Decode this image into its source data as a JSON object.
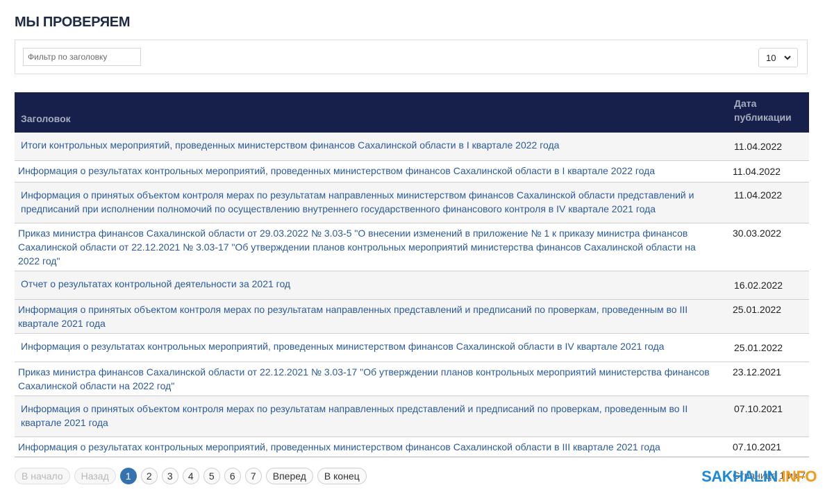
{
  "page_title": "МЫ ПРОВЕРЯЕМ",
  "filter": {
    "placeholder": "Фильтр по заголовку",
    "value": ""
  },
  "page_size": {
    "selected": "10"
  },
  "table": {
    "headers": {
      "title": "Заголовок",
      "date": "Дата публикации"
    },
    "rows": [
      {
        "title": "Итоги контрольных мероприятий, проведенных министерством финансов Сахалинской области в I квартале 2022 года",
        "date": "11.04.2022"
      },
      {
        "title": "Информация о результатах контрольных мероприятий, проведенных министерством финансов Сахалинской области в I квартале 2022 года",
        "date": "11.04.2022"
      },
      {
        "title": "Информация о принятых объектом контроля мерах по результатам направленных министерством финансов Сахалинской области представлений и предписаний при исполнении полномочий по осуществлению внутреннего государственного финансового контроля в IV квартале 2021 года",
        "date": "11.04.2022"
      },
      {
        "title": "Приказ министра финансов Сахалинской области от 29.03.2022 № 3.03-5 \"О внесении изменений в приложение № 1 к приказу министра финансов Сахалинской области от 22.12.2021 № 3.03-17 \"Об утверждении планов контрольных мероприятий министерства финансов Сахалинской области на 2022 год\"",
        "date": "30.03.2022"
      },
      {
        "title": "Отчет о результатах контрольной деятельности за 2021 год",
        "date": "16.02.2022"
      },
      {
        "title": "Информация о принятых объектом контроля мерах по результатам направленных представлений и предписаний по проверкам, проведенным во III квартале 2021 года",
        "date": "25.01.2022"
      },
      {
        "title": "Информация о результатах контрольных мероприятий, проведенных министерством финансов Сахалинской области в IV квартале 2021 года",
        "date": "25.01.2022"
      },
      {
        "title": "Приказ министра финансов Сахалинской области от 22.12.2021 № 3.03-17 \"Об утверждении планов контрольных мероприятий министерства финансов Сахалинской области на 2022 год\"",
        "date": "23.12.2021"
      },
      {
        "title": "Информация о принятых объектом контроля мерах по результатам направленных представлений и предписаний по проверкам, проведенным во II квартале 2021 года",
        "date": "07.10.2021"
      },
      {
        "title": "Информация о результатах контрольных мероприятий, проведенных министерством финансов Сахалинской области в III квартале 2021 года",
        "date": "07.10.2021"
      }
    ]
  },
  "pagination": {
    "first": "В начало",
    "prev": "Назад",
    "pages": [
      "1",
      "2",
      "3",
      "4",
      "5",
      "6",
      "7"
    ],
    "current_page": "1",
    "next": "Вперед",
    "last": "В конец",
    "counter": "Страница 1 из 7"
  },
  "watermark": {
    "part1": "SAKHALIN",
    "part2": ".INFO"
  },
  "colors": {
    "header_bg": "#17204a",
    "link": "#2c5aa0",
    "active_page": "#3572b0",
    "watermark_blue": "#1d88d6",
    "watermark_orange": "#f29a1a"
  },
  "icons": {
    "page_size_chevron": "chevron-down-icon"
  }
}
